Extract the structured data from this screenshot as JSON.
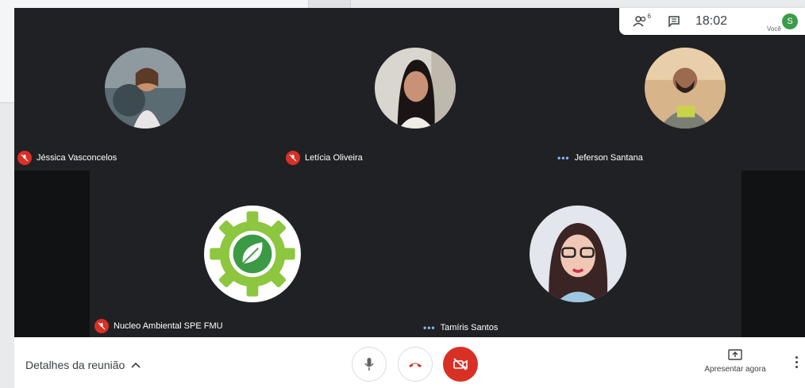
{
  "topbar": {
    "participants_count": "6",
    "time": "18:02",
    "self_label": "Você",
    "self_initial": "S",
    "icons": [
      "people-icon",
      "chat-icon"
    ]
  },
  "participants": [
    {
      "name": "Jéssica Vasconcelos",
      "status": "muted"
    },
    {
      "name": "Letícia Oliveira",
      "status": "muted"
    },
    {
      "name": "Jeferson Santana",
      "status": "speaking-dots"
    },
    {
      "name": "Nucleo Ambiental SPE FMU",
      "status": "muted"
    },
    {
      "name": "Tamíris Santos",
      "status": "speaking-dots"
    }
  ],
  "bottombar": {
    "details_label": "Detalhes da reunião",
    "present_label": "Apresentar agora"
  },
  "colors": {
    "stage": "#202124",
    "mute_red": "#d93025",
    "accent_green": "#3b9d4a",
    "logo_green": "#8dc63f"
  }
}
